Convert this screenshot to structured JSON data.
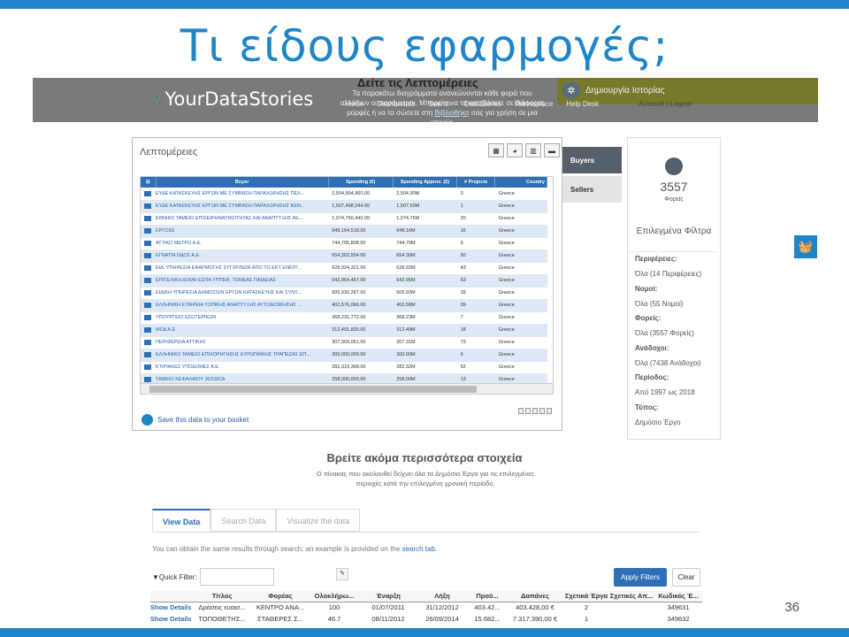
{
  "slide": {
    "title": "Τι είδους εφαρμογές;",
    "number": "36"
  },
  "header": {
    "logo_your": "Your",
    "logo_data": "DataStories",
    "heading": "Δείτε τις Λεπτομέρειες",
    "description_part1": "Τα παρακάτω διαγράμματα ανανεώνονται κάθε φορά που αλλάζουν οι παράμετροι. Μπορείτε να τα κατεβάσετε σε διάφορες μορφές ή να τα σώσετε στη",
    "description_link": "Βιβλιοθήκη",
    "description_part2": "σας για χρήση σε μια ιστορία.",
    "nav": [
      "Home",
      "Dashboards",
      "Search",
      "DataStories",
      "Marketplace",
      "Help Desk"
    ],
    "account": "Account | Logout",
    "story_button": "Δημιουργία Ιστορίας"
  },
  "details": {
    "title": "Λεπτομέρειες",
    "view_icons": [
      "table-view-icon",
      "pie-view-icon",
      "bar-view-icon",
      "list-view-icon"
    ],
    "columns": [
      "Buyer",
      "Spending (€)",
      "Spending Approx. (€)",
      "# Projects",
      "Country"
    ],
    "rows": [
      [
        "ΕΥΔΕ ΚΑΤΑΣΚΕΥΗΣ ΕΡΓΩΝ ΜΕ ΣΥΜΒΑΣΗ ΠΑΡΑΧΩΡΗΣΗΣ ΠΕΛ...",
        "2,504,904,960.00",
        "2,504.90M",
        "3",
        "Greece"
      ],
      [
        "ΕΥΔΕ ΚΑΤΑΣΚΕΥΗΣ ΕΡΓΩΝ ΜΕ ΣΥΜΒΑΣΗ ΠΑΡΑΧΩΡΗΣΗΣ ΚΕΝ...",
        "1,507,498,244.00",
        "1,507.50M",
        "1",
        "Greece"
      ],
      [
        "ΕΘΝΙΚΟ ΤΑΜΕΙΟ ΕΠΙΧΕΙΡΗΜΑΤΙΚΟΤΗΤΑΣ ΚΑΙ ΑΝΑΠΤΥΞΗΣ ΑΕ...",
        "1,074,760,440.00",
        "1,074.76M",
        "20",
        "Greece"
      ],
      [
        "ΕΡΓΟΣΕ",
        "948,164,518.00",
        "948.16M",
        "16",
        "Greece"
      ],
      [
        "ΑΤΤΙΚΟ ΜΕΤΡΟ Α.Ε.",
        "744,785,808.00",
        "744.79M",
        "9",
        "Greece"
      ],
      [
        "ΕΓΝΑΤΙΑ ΟΔΟΣ Α.Ε.",
        "654,302,554.00",
        "654.30M",
        "50",
        "Greece"
      ],
      [
        "ΕΙΔ. ΥΠΗΡΕΣΙΑ ΕΦΑΡΜΟΓΗΣ ΣΥΓΧΡ/ΝΩΝ ΑΠΟ ΤΟ ΕΚΤ ΕΝΕΡΓ...",
        "628,924,321.00",
        "628.92M",
        "43",
        "Greece"
      ],
      [
        "ΕΠΙΤΕΛΙΚΗ ΔΟΜΗ ΕΣΠΑ ΥΠΠΕΘ, ΤΟΜΕΑΣ ΠΑΙΔΕΙΑΣ",
        "542,954,457.00",
        "542.95M",
        "63",
        "Greece"
      ],
      [
        "ΕΙΔΙΚΗ ΥΠΗΡΕΣΙΑ ΔΗΜΟΣΙΩΝ ΕΡΓΩΝ ΚΑΤΑΣΚΕΥΗΣ ΚΑΙ ΣΥΝΤ...",
        "505,930,287.00",
        "505.93M",
        "28",
        "Greece"
      ],
      [
        "ΕΛΛΗΝΙΚΗ ΕΤΑΙΡΕΙΑ ΤΟΠΙΚΗΣ ΑΝΑΠΤΥΞΗΣ ΑΥΤΟΔΙΟΙΚΗΣΗΣ ...",
        "402,576,066.00",
        "402.58M",
        "39",
        "Greece"
      ],
      [
        "ΥΠΟΥΡΓΕΙΟ ΕΣΩΤΕΡΙΚΩΝ",
        "368,231,772.00",
        "368.23M",
        "7",
        "Greece"
      ],
      [
        "ΜΟΔ Α.Ε.",
        "312,491,830.00",
        "312.49M",
        "18",
        "Greece"
      ],
      [
        "ΠΕΡΙΦΕΡΕΙΑ ΑΤΤΙΚΗΣ",
        "307,309,051.00",
        "307.31M",
        "73",
        "Greece"
      ],
      [
        "ΕΛΛΗΝΙΚΟ ΤΑΜΕΙΟ ΕΠΙΧΟΡΗΓΗΣΗΣ ΕΥΡΩΠΑΪΚΗΣ ΤΡΑΠΕΖΑΣ ΕΠ...",
        "300,000,000.00",
        "300.00M",
        "6",
        "Greece"
      ],
      [
        "ΚΤΙΡΙΑΚΕΣ ΥΠΟΔΟΜΕΣ Α.Ε.",
        "282,319,368.00",
        "282.32M",
        "62",
        "Greece"
      ],
      [
        "ΤΑΜΕΙΟ ΚΕΦΑΛΑΙΟΥ JESSICA",
        "258,000,000.00",
        "258.00M",
        "13",
        "Greece"
      ]
    ],
    "basket_link": "Save this data to your basket"
  },
  "side_tabs": {
    "buyers": "Buyers",
    "sellers": "Sellers"
  },
  "sidebar": {
    "count": "3557",
    "count_label": "Φορείς",
    "filters_title": "Επιλεγμένα Φίλτρα",
    "filters": [
      {
        "label": "Περιφέρειες:",
        "value": "Όλα (14 Περιφέρειες)"
      },
      {
        "label": "Νομοί:",
        "value": "Όλα (55 Νομοί)"
      },
      {
        "label": "Φορείς:",
        "value": "Όλα (3557 Φορείς)"
      },
      {
        "label": "Ανάδοχοι:",
        "value": "Όλα (7438 Ανάδοχοι)"
      },
      {
        "label": "Περίοδος:",
        "value": "Από 1997 ως 2018"
      },
      {
        "label": "Τύπος:",
        "value": "Δημόσιο Έργο"
      }
    ]
  },
  "more": {
    "title": "Βρείτε ακόμα περισσότερα στοιχεία",
    "description": "Ο πίνακας που ακολουθεί δείχνει όλα τα Δημόσια Έργα για τις επιλεγμένες περιοχές κατά την επιλεγμένη χρονική περίοδο."
  },
  "tabs": [
    "View Data",
    "Search Data",
    "Visualize the data"
  ],
  "hint": {
    "text": "You can obtain the same results through search: an example is provided on the",
    "link": "search tab."
  },
  "filter": {
    "label": "Quick Filter:",
    "apply": "Apply Filters",
    "clear": "Clear"
  },
  "table2": {
    "columns": [
      "",
      "Τίτλος",
      "Φορέας",
      "Ολοκλήρω...",
      "Έναρξη",
      "Λήξη",
      "Προϋ...",
      "Δαπάνες",
      "Σχετικά Έργα",
      "Σχετικές Απ...",
      "Κωδικός Έ..."
    ],
    "rows": [
      [
        "Show Details",
        "Δράσεις ευαισ...",
        "ΚΕΝΤΡΟ ΑΝΑ...",
        "100",
        "01/07/2011",
        "31/12/2012",
        "403.42...",
        "403.428,00 €",
        "2",
        "",
        "349631"
      ],
      [
        "Show Details",
        "ΤΟΠΟΘΕΤΗΣ...",
        "ΣΤΑΘΕΡΕΣ Σ...",
        "46.7",
        "08/11/2012",
        "26/09/2014",
        "15.682...",
        "7.317.390,00 €",
        "1",
        "",
        "349632"
      ]
    ]
  }
}
